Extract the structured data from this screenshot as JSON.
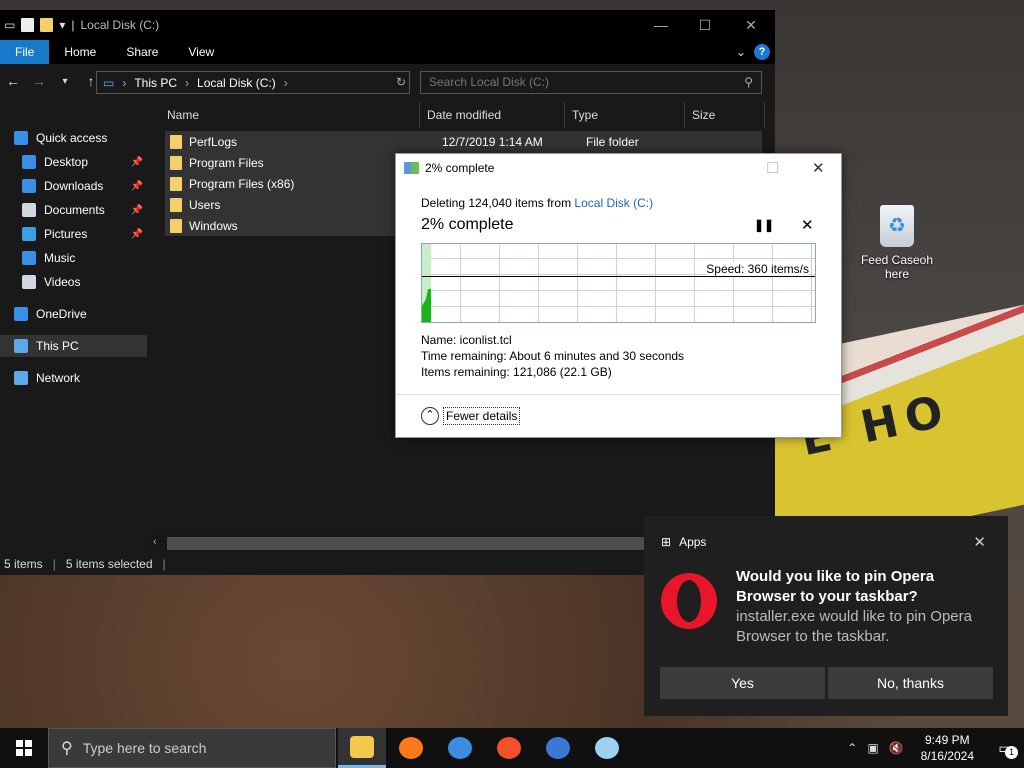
{
  "explorer": {
    "title": "Local Disk (C:)",
    "ribbon_tabs": [
      "File",
      "Home",
      "Share",
      "View"
    ],
    "address": {
      "root": "This PC",
      "current": "Local Disk (C:)"
    },
    "search_placeholder": "Search Local Disk (C:)",
    "sidebar": [
      {
        "label": "Quick access",
        "icon": "star-icon",
        "color": "#3a8ee6",
        "pinned": false
      },
      {
        "label": "Desktop",
        "icon": "desktop-icon",
        "color": "#3a8ee6",
        "pinned": true
      },
      {
        "label": "Downloads",
        "icon": "download-icon",
        "color": "#3a8ee6",
        "pinned": true
      },
      {
        "label": "Documents",
        "icon": "document-icon",
        "color": "#cfd8e0",
        "pinned": true
      },
      {
        "label": "Pictures",
        "icon": "picture-icon",
        "color": "#3aa0e6",
        "pinned": true
      },
      {
        "label": "Music",
        "icon": "music-icon",
        "color": "#3a8ee6",
        "pinned": false
      },
      {
        "label": "Videos",
        "icon": "video-icon",
        "color": "#cfd8e0",
        "pinned": false
      },
      {
        "label": "OneDrive",
        "icon": "cloud-icon",
        "color": "#3a8ee6",
        "pinned": false
      },
      {
        "label": "This PC",
        "icon": "computer-icon",
        "color": "#5fa8e8",
        "pinned": false
      },
      {
        "label": "Network",
        "icon": "network-icon",
        "color": "#5fa8e8",
        "pinned": false
      }
    ],
    "columns": [
      "Name",
      "Date modified",
      "Type",
      "Size"
    ],
    "files": [
      {
        "name": "PerfLogs",
        "date": "12/7/2019 1:14 AM",
        "type": "File folder"
      },
      {
        "name": "Program Files",
        "date": "",
        "type": ""
      },
      {
        "name": "Program Files (x86)",
        "date": "",
        "type": ""
      },
      {
        "name": "Users",
        "date": "",
        "type": ""
      },
      {
        "name": "Windows",
        "date": "",
        "type": ""
      }
    ],
    "status": {
      "items": "5 items",
      "selected": "5 items selected"
    }
  },
  "dialog": {
    "title": "2% complete",
    "deleting_prefix": "Deleting 124,040 items from ",
    "deleting_link": "Local Disk (C:)",
    "percent": "2% complete",
    "progress_fraction": 0.02,
    "speed": "Speed: 360 items/s",
    "name": "Name:  iconlist.tcl",
    "time_remaining": "Time remaining:  About 6 minutes and 30 seconds",
    "items_remaining": "Items remaining:  121,086 (22.1 GB)",
    "fewer_details": "Fewer details"
  },
  "desktop": {
    "recycle_label": "Feed Caseoh here",
    "sign_text": "E HO"
  },
  "toast": {
    "app": "Apps",
    "title": "Would you like to pin Opera Browser to your taskbar?",
    "body": "installer.exe would like to pin Opera Browser to the taskbar.",
    "yes": "Yes",
    "no": "No, thanks"
  },
  "taskbar": {
    "search_placeholder": "Type here to search",
    "time": "9:49 PM",
    "date": "8/16/2024",
    "notification_count": "1",
    "apps": [
      {
        "name": "file-explorer-app-icon",
        "color": "#f2c94c",
        "active": true
      },
      {
        "name": "firefox-app-icon",
        "color": "#ff7a1a",
        "active": false
      },
      {
        "name": "chrome-app-icon",
        "color": "#3d8be0",
        "active": false
      },
      {
        "name": "ea-app-icon",
        "color": "#f2512c",
        "active": false
      },
      {
        "name": "edge-app-icon",
        "color": "#3a78d8",
        "active": false
      },
      {
        "name": "tablet-app-icon",
        "color": "#9ed0ef",
        "active": false
      }
    ]
  }
}
